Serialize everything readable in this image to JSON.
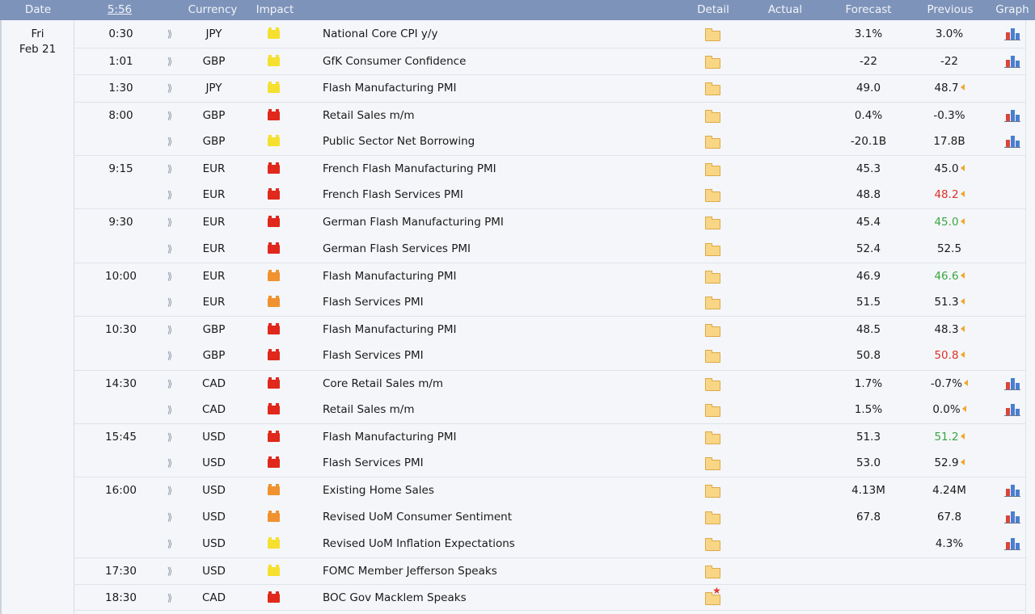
{
  "header": {
    "date": "Date",
    "time": "5:56",
    "currency": "Currency",
    "impact": "Impact",
    "detail": "Detail",
    "actual": "Actual",
    "forecast": "Forecast",
    "previous": "Previous",
    "graph": "Graph"
  },
  "day": {
    "weekday": "Fri",
    "date": "Feb 21"
  },
  "colors": {
    "high": "#e0281c",
    "medium": "#f0922f",
    "low": "#f5e030",
    "better": "#3aa641",
    "worse": "#dd3128",
    "header_bg": "#7d93ba"
  },
  "icons": {
    "impact": "folder-impact-icon",
    "detail": "folder-icon",
    "graph": "bar-chart-icon",
    "revision": "revision-arrow-icon",
    "speech": "bell-icon"
  },
  "events": [
    {
      "time": "0:30",
      "currency": "JPY",
      "impact": "yellow",
      "event": "National Core CPI y/y",
      "actual": "",
      "forecast": "3.1%",
      "previous": "3.0%",
      "prev_color": "",
      "revised": false,
      "graph": true,
      "group_start": true,
      "star": false
    },
    {
      "time": "1:01",
      "currency": "GBP",
      "impact": "yellow",
      "event": "GfK Consumer Confidence",
      "actual": "",
      "forecast": "-22",
      "previous": "-22",
      "prev_color": "",
      "revised": false,
      "graph": true,
      "group_start": true,
      "star": false
    },
    {
      "time": "1:30",
      "currency": "JPY",
      "impact": "yellow",
      "event": "Flash Manufacturing PMI",
      "actual": "",
      "forecast": "49.0",
      "previous": "48.7",
      "prev_color": "",
      "revised": true,
      "graph": false,
      "group_start": true,
      "star": false
    },
    {
      "time": "8:00",
      "currency": "GBP",
      "impact": "red",
      "event": "Retail Sales m/m",
      "actual": "",
      "forecast": "0.4%",
      "previous": "-0.3%",
      "prev_color": "",
      "revised": false,
      "graph": true,
      "group_start": true,
      "star": false
    },
    {
      "time": "",
      "currency": "GBP",
      "impact": "yellow",
      "event": "Public Sector Net Borrowing",
      "actual": "",
      "forecast": "-20.1B",
      "previous": "17.8B",
      "prev_color": "",
      "revised": false,
      "graph": true,
      "group_start": false,
      "star": false
    },
    {
      "time": "9:15",
      "currency": "EUR",
      "impact": "red",
      "event": "French Flash Manufacturing PMI",
      "actual": "",
      "forecast": "45.3",
      "previous": "45.0",
      "prev_color": "",
      "revised": true,
      "graph": false,
      "group_start": true,
      "star": false
    },
    {
      "time": "",
      "currency": "EUR",
      "impact": "red",
      "event": "French Flash Services PMI",
      "actual": "",
      "forecast": "48.8",
      "previous": "48.2",
      "prev_color": "r",
      "revised": true,
      "graph": false,
      "group_start": false,
      "star": false
    },
    {
      "time": "9:30",
      "currency": "EUR",
      "impact": "red",
      "event": "German Flash Manufacturing PMI",
      "actual": "",
      "forecast": "45.4",
      "previous": "45.0",
      "prev_color": "g",
      "revised": true,
      "graph": false,
      "group_start": true,
      "star": false
    },
    {
      "time": "",
      "currency": "EUR",
      "impact": "red",
      "event": "German Flash Services PMI",
      "actual": "",
      "forecast": "52.4",
      "previous": "52.5",
      "prev_color": "",
      "revised": false,
      "graph": false,
      "group_start": false,
      "star": false
    },
    {
      "time": "10:00",
      "currency": "EUR",
      "impact": "orange",
      "event": "Flash Manufacturing PMI",
      "actual": "",
      "forecast": "46.9",
      "previous": "46.6",
      "prev_color": "g",
      "revised": true,
      "graph": false,
      "group_start": true,
      "star": false
    },
    {
      "time": "",
      "currency": "EUR",
      "impact": "orange",
      "event": "Flash Services PMI",
      "actual": "",
      "forecast": "51.5",
      "previous": "51.3",
      "prev_color": "",
      "revised": true,
      "graph": false,
      "group_start": false,
      "star": false
    },
    {
      "time": "10:30",
      "currency": "GBP",
      "impact": "red",
      "event": "Flash Manufacturing PMI",
      "actual": "",
      "forecast": "48.5",
      "previous": "48.3",
      "prev_color": "",
      "revised": true,
      "graph": false,
      "group_start": true,
      "star": false
    },
    {
      "time": "",
      "currency": "GBP",
      "impact": "red",
      "event": "Flash Services PMI",
      "actual": "",
      "forecast": "50.8",
      "previous": "50.8",
      "prev_color": "r",
      "revised": true,
      "graph": false,
      "group_start": false,
      "star": false
    },
    {
      "time": "14:30",
      "currency": "CAD",
      "impact": "red",
      "event": "Core Retail Sales m/m",
      "actual": "",
      "forecast": "1.7%",
      "previous": "-0.7%",
      "prev_color": "",
      "revised": true,
      "graph": true,
      "group_start": true,
      "star": false
    },
    {
      "time": "",
      "currency": "CAD",
      "impact": "red",
      "event": "Retail Sales m/m",
      "actual": "",
      "forecast": "1.5%",
      "previous": "0.0%",
      "prev_color": "",
      "revised": true,
      "graph": true,
      "group_start": false,
      "star": false
    },
    {
      "time": "15:45",
      "currency": "USD",
      "impact": "red",
      "event": "Flash Manufacturing PMI",
      "actual": "",
      "forecast": "51.3",
      "previous": "51.2",
      "prev_color": "g",
      "revised": true,
      "graph": false,
      "group_start": true,
      "star": false
    },
    {
      "time": "",
      "currency": "USD",
      "impact": "red",
      "event": "Flash Services PMI",
      "actual": "",
      "forecast": "53.0",
      "previous": "52.9",
      "prev_color": "",
      "revised": true,
      "graph": false,
      "group_start": false,
      "star": false
    },
    {
      "time": "16:00",
      "currency": "USD",
      "impact": "orange",
      "event": "Existing Home Sales",
      "actual": "",
      "forecast": "4.13M",
      "previous": "4.24M",
      "prev_color": "",
      "revised": false,
      "graph": true,
      "group_start": true,
      "star": false
    },
    {
      "time": "",
      "currency": "USD",
      "impact": "orange",
      "event": "Revised UoM Consumer Sentiment",
      "actual": "",
      "forecast": "67.8",
      "previous": "67.8",
      "prev_color": "",
      "revised": false,
      "graph": true,
      "group_start": false,
      "star": false
    },
    {
      "time": "",
      "currency": "USD",
      "impact": "yellow",
      "event": "Revised UoM Inflation Expectations",
      "actual": "",
      "forecast": "",
      "previous": "4.3%",
      "prev_color": "",
      "revised": false,
      "graph": true,
      "group_start": false,
      "star": false
    },
    {
      "time": "17:30",
      "currency": "USD",
      "impact": "yellow",
      "event": "FOMC Member Jefferson Speaks",
      "actual": "",
      "forecast": "",
      "previous": "",
      "prev_color": "",
      "revised": false,
      "graph": false,
      "group_start": true,
      "star": false
    },
    {
      "time": "18:30",
      "currency": "CAD",
      "impact": "red",
      "event": "BOC Gov Macklem Speaks",
      "actual": "",
      "forecast": "",
      "previous": "",
      "prev_color": "",
      "revised": false,
      "graph": false,
      "group_start": true,
      "star": true
    }
  ]
}
